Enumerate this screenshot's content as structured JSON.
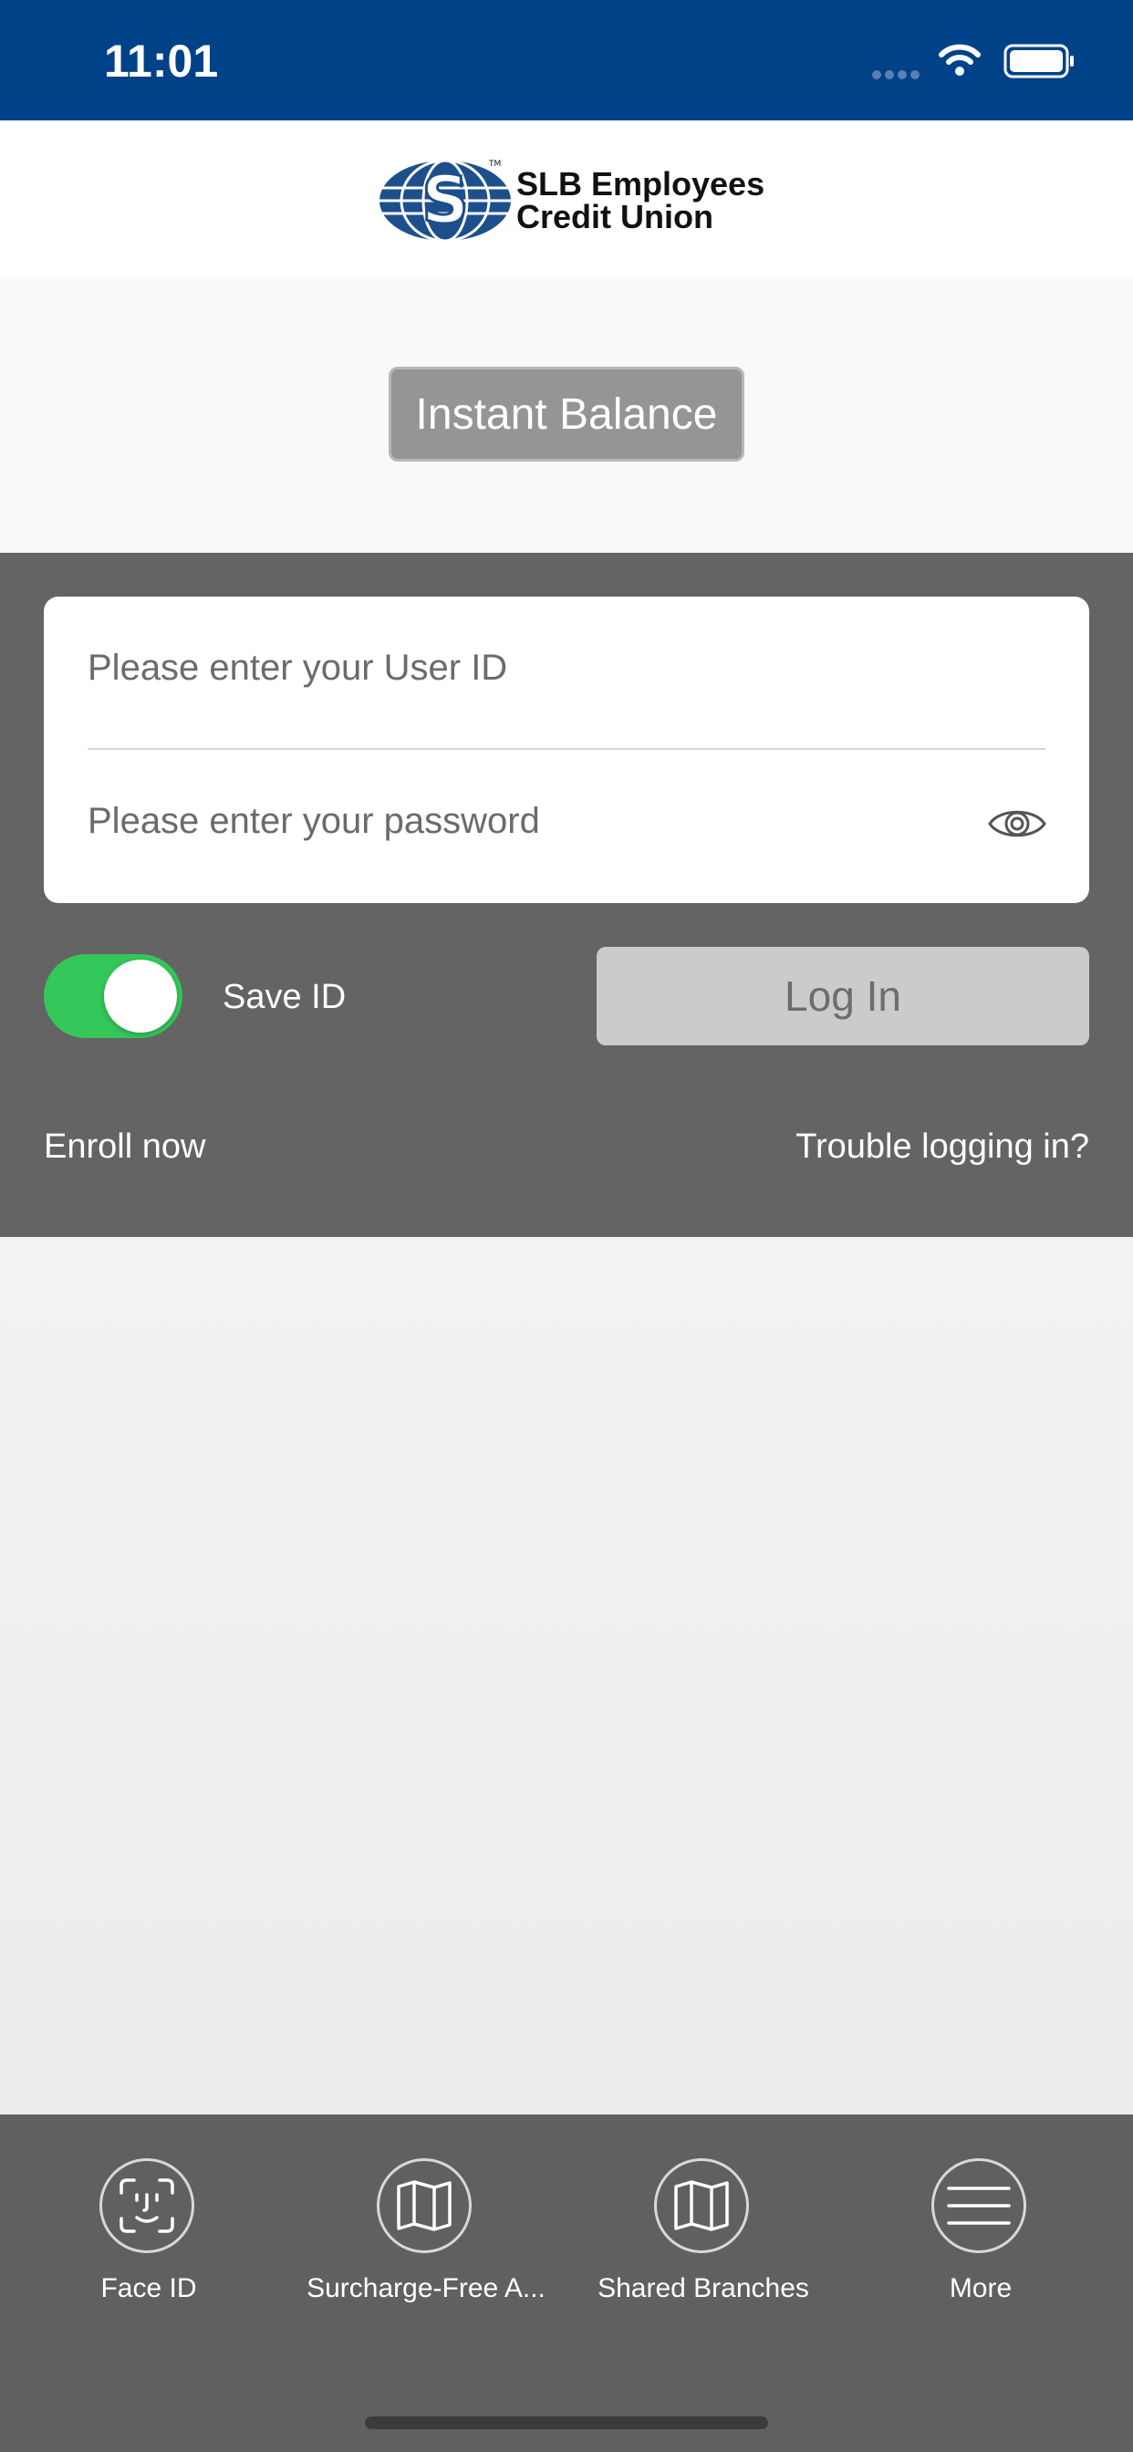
{
  "status_bar": {
    "time": "11:01"
  },
  "header": {
    "logo_line1": "SLB Employees",
    "logo_line2": "Credit Union",
    "trademark": "TM"
  },
  "instant_balance": {
    "label": "Instant Balance"
  },
  "login": {
    "user_id_placeholder": "Please enter your User ID",
    "password_placeholder": "Please enter your password",
    "save_id_label": "Save ID",
    "save_id_on": true,
    "login_button": "Log In",
    "enroll_link": "Enroll now",
    "trouble_link": "Trouble logging in?"
  },
  "tab_bar": {
    "items": [
      {
        "label": "Face ID",
        "icon": "face-id-icon"
      },
      {
        "label": "Surcharge-Free A...",
        "icon": "map-icon"
      },
      {
        "label": "Shared Branches",
        "icon": "map-icon"
      },
      {
        "label": "More",
        "icon": "menu-icon"
      }
    ]
  },
  "colors": {
    "status_bar": "#004288",
    "panel": "#646464",
    "toggle_on": "#34c759",
    "logo_blue": "#1d4f8c"
  }
}
